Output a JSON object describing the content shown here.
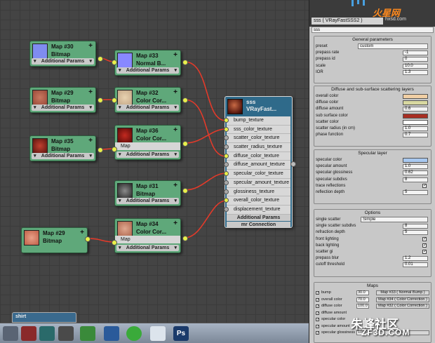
{
  "nodes": {
    "map30": {
      "title": "Map #30",
      "type": "Bitmap",
      "footer": "Additional Params"
    },
    "map33": {
      "title": "Map #33",
      "type": "Normal B...",
      "footer": "Additional Params"
    },
    "map29a": {
      "title": "Map #29",
      "type": "Bitmap",
      "footer": "Additional Params"
    },
    "map32": {
      "title": "Map #32",
      "type": "Color Cor...",
      "footer": "Additional Params"
    },
    "map35": {
      "title": "Map #35",
      "type": "Bitmap",
      "footer": "Additional Params"
    },
    "map36": {
      "title": "Map #36",
      "type": "Color Cor...",
      "slot": "Map",
      "footer": "Additional Params"
    },
    "map31": {
      "title": "Map #31",
      "type": "Bitmap",
      "footer": "Additional Params"
    },
    "map29b": {
      "title": "Map #29",
      "type": "Bitmap"
    },
    "map34": {
      "title": "Map #34",
      "type": "Color Cor...",
      "slot": "Map",
      "footer": "Additional Params"
    }
  },
  "vray": {
    "title": "sss",
    "type": "VRayFast...",
    "slots": [
      "bump_texture",
      "sss_color_texture",
      "scatter_color_texture",
      "scatter_radius_texture",
      "diffuse_color_texture",
      "diffuse_amount_texture",
      "specular_color_texture",
      "specular_amount_texture",
      "glossiness_texture",
      "overall_color_texture",
      "displacement_texture"
    ],
    "footer1": "Additional Params",
    "footer2": "mr Connection"
  },
  "shirt_label": "shirt",
  "panel": {
    "header_title": "sss  ( VRayFastSSS2 )",
    "logo": "火星网",
    "logo_sub": "hxsd.com",
    "name": "sss",
    "general": {
      "title": "General parameters",
      "preset_label": "preset",
      "preset_value": "custom",
      "rows": [
        {
          "label": "prepass rate",
          "value": "-1"
        },
        {
          "label": "prepass id",
          "value": "0"
        },
        {
          "label": "scale",
          "value": "10.0"
        },
        {
          "label": "IOR",
          "value": "1.3"
        }
      ]
    },
    "diffuse": {
      "title": "Diffuse and sub-surface scattering layers",
      "overall_color": "overall color",
      "diffuse_color": "diffuse color",
      "diffuse_amount": "diffuse amount",
      "diffuse_amount_value": "0.6",
      "sub_surface_color": "sub surface color",
      "scatter_color": "scatter color",
      "scatter_radius": "scatter radius (in cm)",
      "scatter_radius_value": "1.0",
      "phase_function": "phase function",
      "phase_function_value": "0.7",
      "colors": {
        "overall": "#f1cfa4",
        "diffuse": "#d8d8a0",
        "sub_surface": "#a82e22",
        "scatter": "#ffffff"
      }
    },
    "specular": {
      "title": "Specular layer",
      "specular_color": "specular color",
      "specular_color_hex": "#a8c8f0",
      "rows": [
        {
          "label": "specular amount",
          "value": "1.0"
        },
        {
          "label": "specular glossiness",
          "value": "0.62"
        },
        {
          "label": "specular subdivs",
          "value": "8"
        }
      ],
      "trace_reflections": "trace reflections",
      "reflection_depth": "reflection depth",
      "reflection_depth_value": "5"
    },
    "options": {
      "title": "Options",
      "single_scatter": "single scatter",
      "single_scatter_value": "Simple",
      "rows": [
        {
          "label": "single scatter subdivs",
          "value": "8"
        },
        {
          "label": "refraction depth",
          "value": "5"
        }
      ],
      "checks": [
        "front lighting",
        "back lighting",
        "scatter gi"
      ],
      "prepass_blur": "prepass blur",
      "prepass_blur_value": "1.2",
      "cutoff_threshold": "cutoff threshold",
      "cutoff_threshold_value": "0.01"
    },
    "maps": {
      "title": "Maps",
      "rows": [
        {
          "label": "bump",
          "value": "30.0",
          "map": "Map #33  ( Normal Bump )"
        },
        {
          "label": "overall color",
          "value": "70.0",
          "map": "Map #34  ( Color Correction )"
        },
        {
          "label": "diffuse color",
          "value": "100.0",
          "map": "Map #32  ( Color Correction )"
        },
        {
          "label": "diffuse amount",
          "value": "",
          "map": ""
        },
        {
          "label": "specular color",
          "value": "",
          "map": ""
        },
        {
          "label": "specular amount",
          "value": "",
          "map": ""
        },
        {
          "label": "specular glossiness",
          "value": "100.0",
          "map": "None"
        }
      ]
    }
  },
  "watermark": {
    "line1": "朱峰社区",
    "line2": "ZF3D.COM"
  },
  "taskbar": {
    "ps_label": "Ps"
  }
}
